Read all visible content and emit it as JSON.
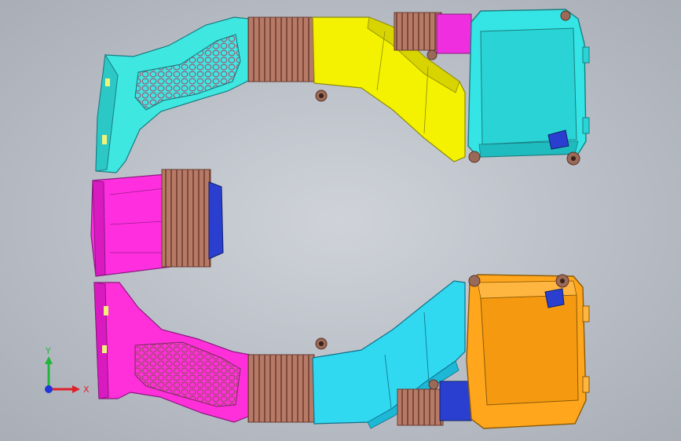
{
  "viewport": {
    "background_color": "#bcc1c8"
  },
  "parts": {
    "upper_duct_color": "#3ee6e0",
    "upper_resonator_color": "#f3f200",
    "upper_airbox_color": "#33e4e4",
    "middle_intake_color": "#ff2fe0",
    "lower_duct_color": "#ff30d9",
    "lower_resonator_color": "#2fd8ef",
    "lower_airbox_color": "#ffa61c",
    "bellows_color": "#b07060",
    "sensor_color": "#2a3fd0",
    "hex_grid_color": "#b86a82"
  },
  "triad": {
    "x_label": "X",
    "y_label": "Y",
    "x_color": "#e0202a",
    "y_color": "#22b43a",
    "z_color": "#2036d8"
  }
}
